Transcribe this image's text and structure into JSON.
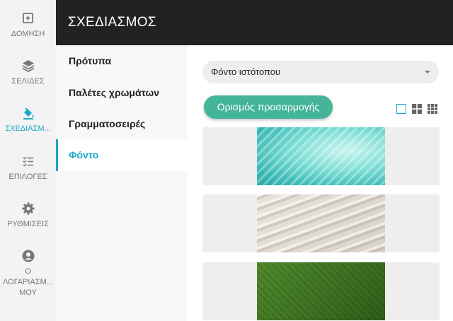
{
  "rail": {
    "items": [
      {
        "label": "ΔΟΜΗΣΗ",
        "icon": "add-square-icon"
      },
      {
        "label": "ΣΕΛΙΔΕΣ",
        "icon": "layers-icon"
      },
      {
        "label": "ΣΧΕΔΙΑΣΜ...",
        "icon": "paint-bucket-icon"
      },
      {
        "label": "ΕΠΙΛΟΓΕΣ",
        "icon": "checklist-icon"
      },
      {
        "label": "ΡΥΘΜΙΣΕΙΣ",
        "icon": "gear-icon"
      },
      {
        "label": "Ο ΛΟΓΑΡΙΑΣΜ... ΜΟΥ",
        "icon": "account-icon"
      }
    ],
    "active_color": "#1ba6c9"
  },
  "header": {
    "title": "ΣΧΕΔΙΑΣΜΟΣ"
  },
  "submenu": {
    "items": [
      {
        "label": "Πρότυπα"
      },
      {
        "label": "Παλέτες χρωμάτων"
      },
      {
        "label": "Γραμματοσειρές"
      },
      {
        "label": "Φόντο"
      }
    ]
  },
  "main": {
    "select_value": "Φόντο ιστότοπου",
    "custom_button": "Ορισμός προσαρμογής",
    "accent": "#45b59a",
    "backgrounds": [
      {
        "name": "teal-brushstroke"
      },
      {
        "name": "sand-ripples"
      },
      {
        "name": "green-leaf"
      }
    ]
  }
}
